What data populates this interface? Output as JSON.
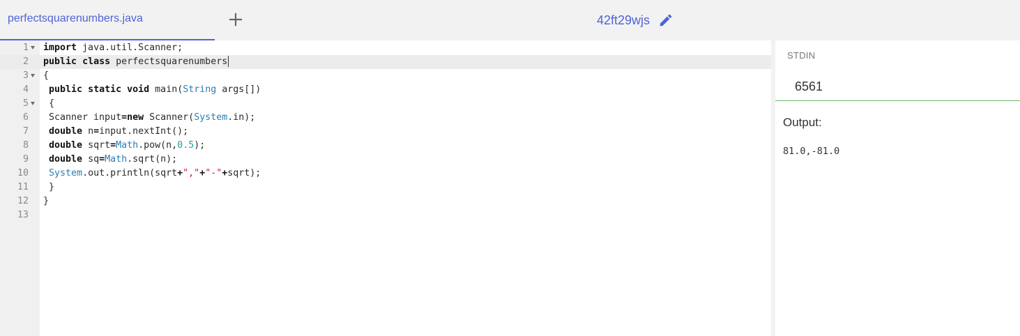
{
  "header": {
    "file_tab": "perfectsquarenumbers.java",
    "project_name": "42ft29wjs"
  },
  "editor": {
    "lines": [
      {
        "n": "1",
        "fold": true,
        "tokens": [
          [
            "kw",
            "import"
          ],
          [
            "",
            " java.util.Scanner;"
          ]
        ]
      },
      {
        "n": "2",
        "fold": false,
        "active": true,
        "tokens": [
          [
            "kw",
            "public"
          ],
          [
            "",
            " "
          ],
          [
            "kw",
            "class"
          ],
          [
            "",
            " perfectsquarenumbers"
          ]
        ]
      },
      {
        "n": "3",
        "fold": true,
        "tokens": [
          [
            "",
            "{"
          ]
        ]
      },
      {
        "n": "4",
        "fold": false,
        "tokens": [
          [
            "",
            " "
          ],
          [
            "kw",
            "public"
          ],
          [
            "",
            " "
          ],
          [
            "kw",
            "static"
          ],
          [
            "",
            " "
          ],
          [
            "kw",
            "void"
          ],
          [
            "",
            " main("
          ],
          [
            "ty",
            "String"
          ],
          [
            "",
            " args[])"
          ]
        ]
      },
      {
        "n": "5",
        "fold": true,
        "tokens": [
          [
            "",
            " {"
          ]
        ]
      },
      {
        "n": "6",
        "fold": false,
        "tokens": [
          [
            "",
            " Scanner input"
          ],
          [
            "kw",
            "="
          ],
          [
            "kw",
            "new"
          ],
          [
            "",
            " Scanner("
          ],
          [
            "ty",
            "System"
          ],
          [
            "",
            ".in);"
          ]
        ]
      },
      {
        "n": "7",
        "fold": false,
        "tokens": [
          [
            "",
            " "
          ],
          [
            "kw",
            "double"
          ],
          [
            "",
            " n"
          ],
          [
            "kw",
            "="
          ],
          [
            "",
            "input.nextInt();"
          ]
        ]
      },
      {
        "n": "8",
        "fold": false,
        "tokens": [
          [
            "",
            " "
          ],
          [
            "kw",
            "double"
          ],
          [
            "",
            " sqrt"
          ],
          [
            "kw",
            "="
          ],
          [
            "ty",
            "Math"
          ],
          [
            "",
            ".pow(n,"
          ],
          [
            "num",
            "0.5"
          ],
          [
            "",
            ");"
          ]
        ]
      },
      {
        "n": "9",
        "fold": false,
        "tokens": [
          [
            "",
            " "
          ],
          [
            "kw",
            "double"
          ],
          [
            "",
            " sq"
          ],
          [
            "kw",
            "="
          ],
          [
            "ty",
            "Math"
          ],
          [
            "",
            ".sqrt(n);"
          ]
        ]
      },
      {
        "n": "10",
        "fold": false,
        "tokens": [
          [
            "",
            " "
          ],
          [
            "ty",
            "System"
          ],
          [
            "",
            ".out.println(sqrt"
          ],
          [
            "kw",
            "+"
          ],
          [
            "str",
            "\",\""
          ],
          [
            "kw",
            "+"
          ],
          [
            "str",
            "\"-\""
          ],
          [
            "kw",
            "+"
          ],
          [
            "",
            "sqrt);"
          ]
        ]
      },
      {
        "n": "11",
        "fold": false,
        "tokens": [
          [
            "",
            " }"
          ]
        ]
      },
      {
        "n": "12",
        "fold": false,
        "tokens": [
          [
            "",
            "}"
          ]
        ]
      },
      {
        "n": "13",
        "fold": false,
        "tokens": []
      }
    ]
  },
  "side": {
    "stdin_label": "STDIN",
    "stdin_value": "6561",
    "output_label": "Output:",
    "output_value": "81.0,-81.0"
  },
  "colors": {
    "accent": "#4f63d8",
    "stdin_underline": "#6dbb6d",
    "keyword": "#111111",
    "type": "#2a7db5",
    "number": "#1aa39a",
    "string": "#c91b39"
  },
  "icons": {
    "add_tab": "plus-icon",
    "edit_project": "pencil-icon"
  }
}
